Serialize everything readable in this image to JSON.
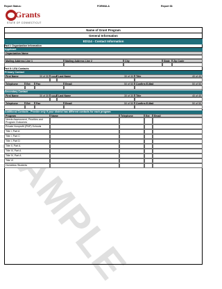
{
  "header": {
    "report_status": "Report Status:",
    "formula": "FORMULA",
    "report_id": "Report ID:",
    "logo_text": "Grants",
    "logo_sub": "STATE OF CONNECTICUT"
  },
  "titles": {
    "program": "Name of Grant Program",
    "general": "General Information",
    "contact": "ED114 - Contact Information"
  },
  "part1": {
    "heading": "Part I: Organization Information",
    "applicant": "Applicant",
    "org_name": "Organization Name",
    "addr1": "Mailing Address Line 1",
    "addr2": "Mailing Address Line 2",
    "city": "City",
    "state": "State",
    "zip": "Zip Code"
  },
  "part2": {
    "heading": "Part II: LEA Contacts",
    "primary": "Primary Contact",
    "secondary": "Secondary Contact",
    "first": "First Name",
    "first_count": "30 of 30",
    "initial": "Initial",
    "last": "Last Name",
    "last_count": "30 of 30",
    "title": "Title",
    "title_count": "40 of 40",
    "telephone": "Telephone",
    "ext": "Ext",
    "fax": "Fax",
    "email": "Email",
    "email_count": "50 of 50",
    "confirm": "Confirm E-Mail",
    "confirm_count": "50 of 50"
  },
  "additional": {
    "heading": "Additional Contacts - Provide only if your district has different contacts for each program",
    "col_program": "Program",
    "col_name": "Name",
    "col_telephone": "Telephone",
    "col_ext": "Ext",
    "col_email": "Email",
    "rows": [
      "Needs Assessment, Priorities and Program Outcomes",
      "Private Nonprofit (PNP) Schools",
      "Title I, Part A",
      "Title I, Part C",
      "Title I, Part D",
      "Title II, Part A",
      "Title III, Part A",
      "Title IV, Part A",
      "Title VI",
      "Homeless Students"
    ]
  },
  "watermark": "SAMPLE"
}
